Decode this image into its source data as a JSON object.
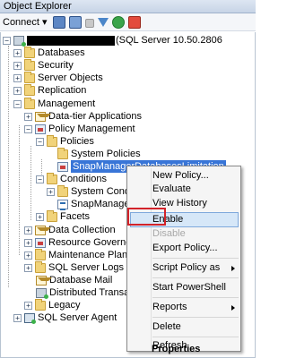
{
  "window": {
    "title": "Object Explorer"
  },
  "toolbar": {
    "connect_label": "Connect ▾",
    "icons": [
      "connect-icon",
      "disconnect-icon",
      "stop-icon",
      "filter-icon",
      "refresh-icon",
      "summary-icon"
    ]
  },
  "tree": {
    "server_label": "(SQL Server 10.50.2806",
    "nodes": [
      {
        "label": "Databases"
      },
      {
        "label": "Security"
      },
      {
        "label": "Server Objects"
      },
      {
        "label": "Replication"
      },
      {
        "label": "Management"
      },
      {
        "label": "Data-tier Applications"
      },
      {
        "label": "Policy Management"
      },
      {
        "label": "Policies"
      },
      {
        "label": "System Policies"
      },
      {
        "label": "SnapManagerDatabasesLimitation"
      },
      {
        "label": "Conditions"
      },
      {
        "label": "System Conditions"
      },
      {
        "label": "SnapManagerDat"
      },
      {
        "label": "Facets"
      },
      {
        "label": "Data Collection"
      },
      {
        "label": "Resource Governor"
      },
      {
        "label": "Maintenance Plans"
      },
      {
        "label": "SQL Server Logs"
      },
      {
        "label": "Database Mail"
      },
      {
        "label": "Distributed Transaction"
      },
      {
        "label": "Legacy"
      },
      {
        "label": "SQL Server Agent"
      }
    ]
  },
  "context_menu": {
    "items": [
      {
        "label": "New Policy..."
      },
      {
        "label": "Evaluate"
      },
      {
        "label": "View History"
      },
      {
        "label": "Enable"
      },
      {
        "label": "Disable"
      },
      {
        "label": "Export Policy..."
      },
      {
        "label": "Script Policy as"
      },
      {
        "label": "Start PowerShell"
      },
      {
        "label": "Reports"
      },
      {
        "label": "Delete"
      },
      {
        "label": "Refresh"
      },
      {
        "label": "Properties"
      }
    ]
  },
  "colors": {
    "selection": "#3875d7",
    "highlight_box": "#d2232a"
  }
}
